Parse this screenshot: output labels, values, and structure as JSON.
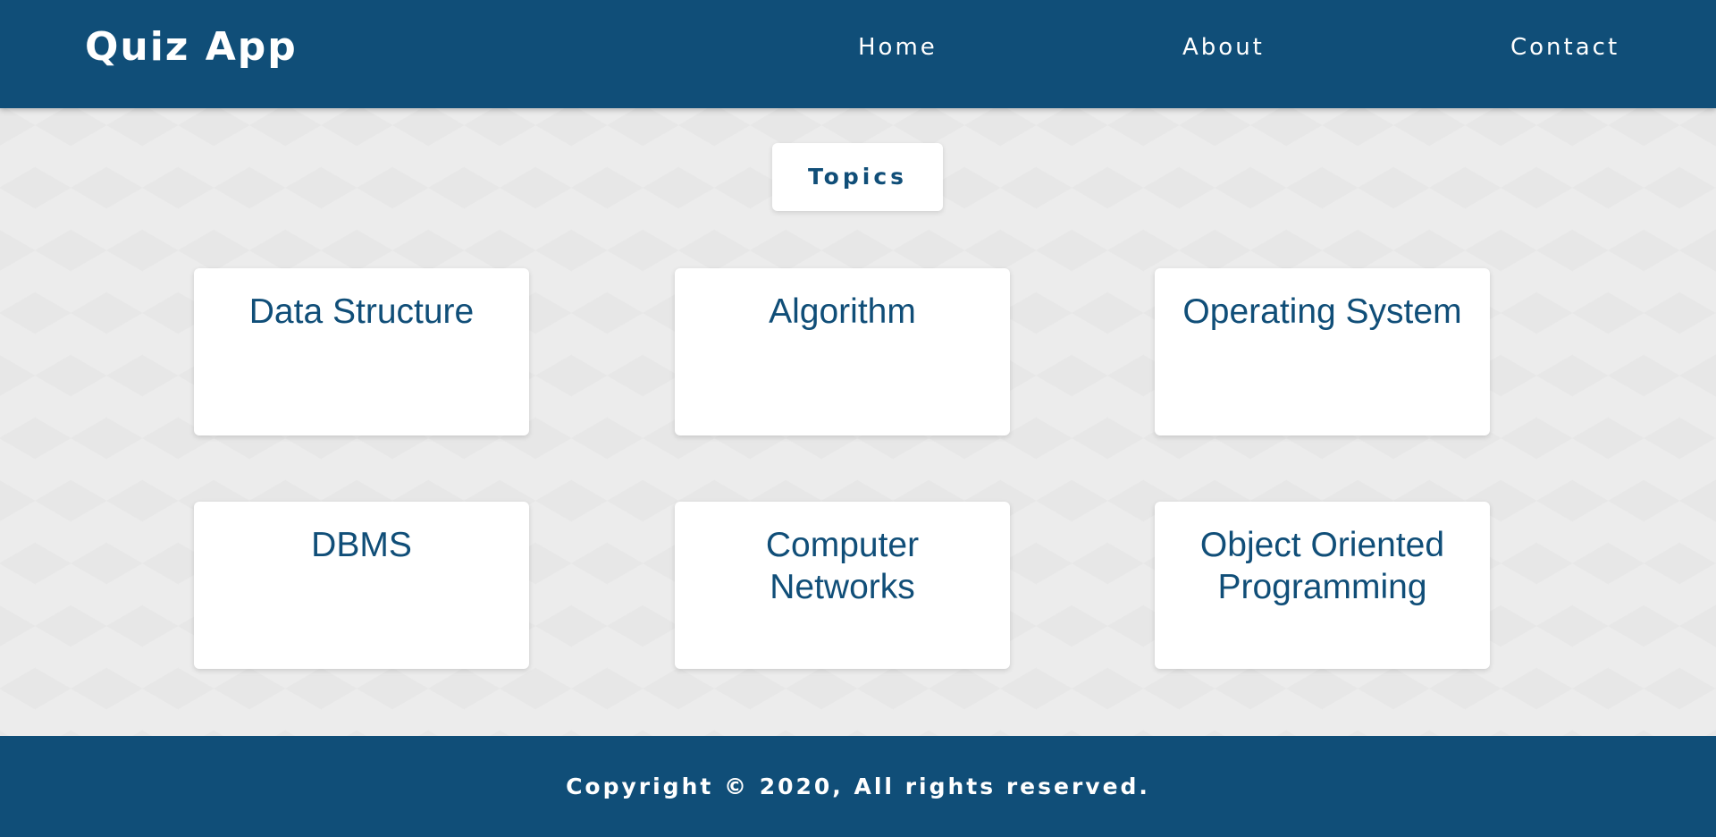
{
  "header": {
    "brand": "Quiz App",
    "nav": {
      "home": "Home",
      "about": "About",
      "contact": "Contact"
    }
  },
  "main": {
    "section_label": "Topics",
    "topics": [
      "Data Structure",
      "Algorithm",
      "Operating System",
      "DBMS",
      "Computer Networks",
      "Object Oriented Programming"
    ]
  },
  "footer": {
    "text": "Copyright © 2020, All rights reserved."
  },
  "colors": {
    "primary": "#104e78",
    "background": "#ececec",
    "card": "#ffffff"
  }
}
